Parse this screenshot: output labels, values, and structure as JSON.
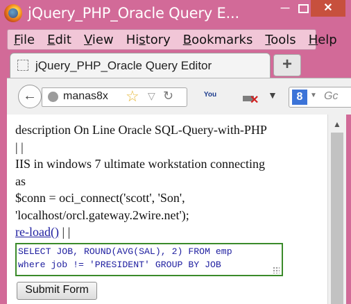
{
  "window": {
    "title": "jQuery_PHP_Oracle Query E...",
    "minimize_glyph": "─",
    "close_glyph": "✕"
  },
  "menu": [
    {
      "access": "F",
      "rest": "ile"
    },
    {
      "access": "E",
      "rest": "dit"
    },
    {
      "access": "V",
      "rest": "iew"
    },
    {
      "pre": "Hi",
      "access": "s",
      "rest": "tory"
    },
    {
      "access": "B",
      "rest": "ookmarks"
    },
    {
      "access": "T",
      "rest": "ools"
    },
    {
      "access": "H",
      "rest": "elp"
    }
  ],
  "tab": {
    "label": "jQuery_PHP_Oracle Query Editor",
    "new_tab_glyph": "+"
  },
  "nav": {
    "back_glyph": "←",
    "url": "manas8x",
    "star_glyph": "☆",
    "dropdown_glyph": "▽",
    "reload_glyph": "↻",
    "youtube_label": "You",
    "download_x": "✕",
    "menu_drop_glyph": "▼",
    "search_engine_letter": "8",
    "search_dropdown": "▼",
    "search_placeholder": "Gc"
  },
  "content": {
    "line1": "description On Line Oracle SQL-Query-with-PHP",
    "line2": "| |",
    "line3": "IIS in windows 7 ultimate workstation connecting",
    "line4": "as",
    "line5": "$conn = oci_connect('scott', 'Son',",
    "line6": "'localhost/orcl.gateway.2wire.net');",
    "reload_link": "re-load()",
    "separator": " | |",
    "query_line1": "SELECT JOB, ROUND(AVG(SAL), 2) FROM emp",
    "query_line2": "where job != 'PRESIDENT' GROUP BY JOB",
    "submit_label": "Submit Form"
  },
  "scrollbar": {
    "up_glyph": "▲"
  }
}
